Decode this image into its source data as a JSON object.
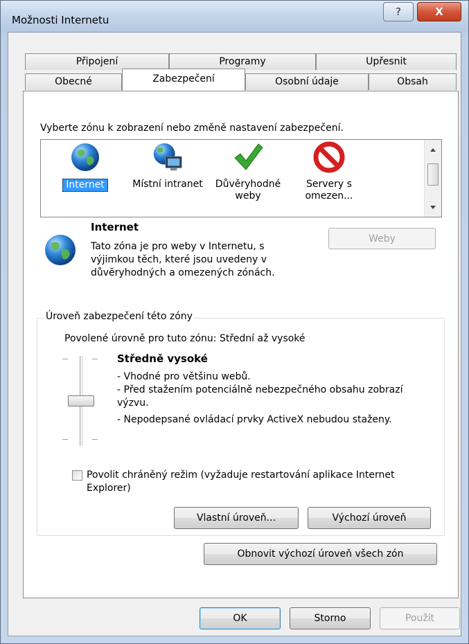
{
  "window": {
    "title": "Možnosti Internetu",
    "help_glyph": "?",
    "close_glyph": "X"
  },
  "tabs_top": [
    {
      "label": "Připojení"
    },
    {
      "label": "Programy"
    },
    {
      "label": "Upřesnit"
    }
  ],
  "tabs_bottom": [
    {
      "label": "Obecné"
    },
    {
      "label": "Zabezpečení",
      "active": true
    },
    {
      "label": "Osobní údaje"
    },
    {
      "label": "Obsah"
    }
  ],
  "zones": {
    "prompt": "Vyberte zónu k zobrazení nebo změně nastavení zabezpečení.",
    "items": [
      {
        "label": "Internet",
        "icon": "globe-icon",
        "selected": true
      },
      {
        "label": "Místní intranet",
        "icon": "intranet-icon"
      },
      {
        "label": "Důvěryhodné weby",
        "icon": "checkmark-icon"
      },
      {
        "label": "Servery s omezen...",
        "icon": "prohibited-icon"
      }
    ]
  },
  "zone_info": {
    "name": "Internet",
    "description": "Tato zóna je pro weby v Internetu, s výjimkou těch, které jsou uvedeny v důvěryhodných a omezených zónách.",
    "sites_button": "Weby"
  },
  "security_level": {
    "group_title": "Úroveň zabezpečení této zóny",
    "allowed_levels": "Povolené úrovně pro tuto zónu: Střední až vysoké",
    "level_name": "Středně vysoké",
    "bullets": [
      "- Vhodné pro většinu webů.",
      "- Před stažením potenciálně nebezpečného obsahu zobrazí výzvu.",
      "- Nepodepsané ovládací prvky ActiveX nebudou staženy."
    ],
    "slider_level": "Středně vysoké",
    "protected_mode_label": "Povolit chráněný režim (vyžaduje restartování aplikace Internet Explorer)",
    "protected_mode_checked": false,
    "custom_level_button": "Vlastní úroveň...",
    "default_level_button": "Výchozí úroveň"
  },
  "reset_all_button": "Obnovit výchozí úroveň všech zón",
  "footer": {
    "ok": "OK",
    "cancel": "Storno",
    "apply": "Použít"
  },
  "colors": {
    "selection": "#3399ff",
    "close_button": "#c23d1f",
    "checkmark": "#3aa634",
    "prohibited": "#d42020"
  }
}
